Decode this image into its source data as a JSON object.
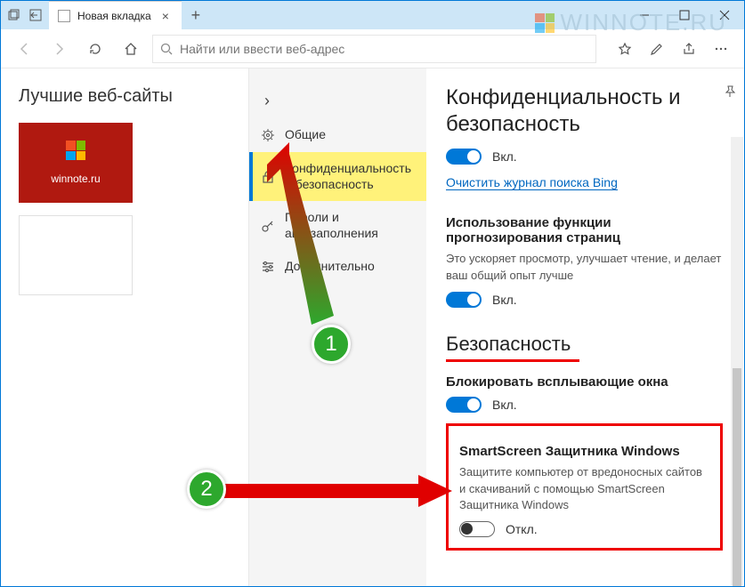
{
  "titlebar": {
    "tab_title": "Новая вкладка"
  },
  "toolbar": {
    "search_placeholder": "Найти или ввести веб-адрес"
  },
  "main": {
    "heading": "Лучшие веб-сайты",
    "tile_label": "winnote.ru"
  },
  "sidebar": {
    "items": [
      {
        "label": "Общие"
      },
      {
        "label": "Конфиденциальность и безопасность"
      },
      {
        "label": "Пароли и автозаполнения"
      },
      {
        "label": "Дополнительно"
      }
    ]
  },
  "panel": {
    "title": "Конфиденциальность и безопасность",
    "toggle_on": "Вкл.",
    "toggle_off": "Откл.",
    "clear_link": "Очистить журнал поиска Bing",
    "predict_heading": "Использование функции прогнозирования страниц",
    "predict_desc": "Это ускоряет просмотр, улучшает чтение, и делает ваш общий опыт лучше",
    "security_heading": "Безопасность",
    "popup_heading": "Блокировать всплывающие окна",
    "smartscreen_heading": "SmartScreen Защитника Windows",
    "smartscreen_desc": "Защитите компьютер от вредоносных сайтов и скачиваний с помощью SmartScreen Защитника Windows"
  },
  "watermark": "WINNOTE.RU",
  "annotations": {
    "badge1": "1",
    "badge2": "2"
  }
}
